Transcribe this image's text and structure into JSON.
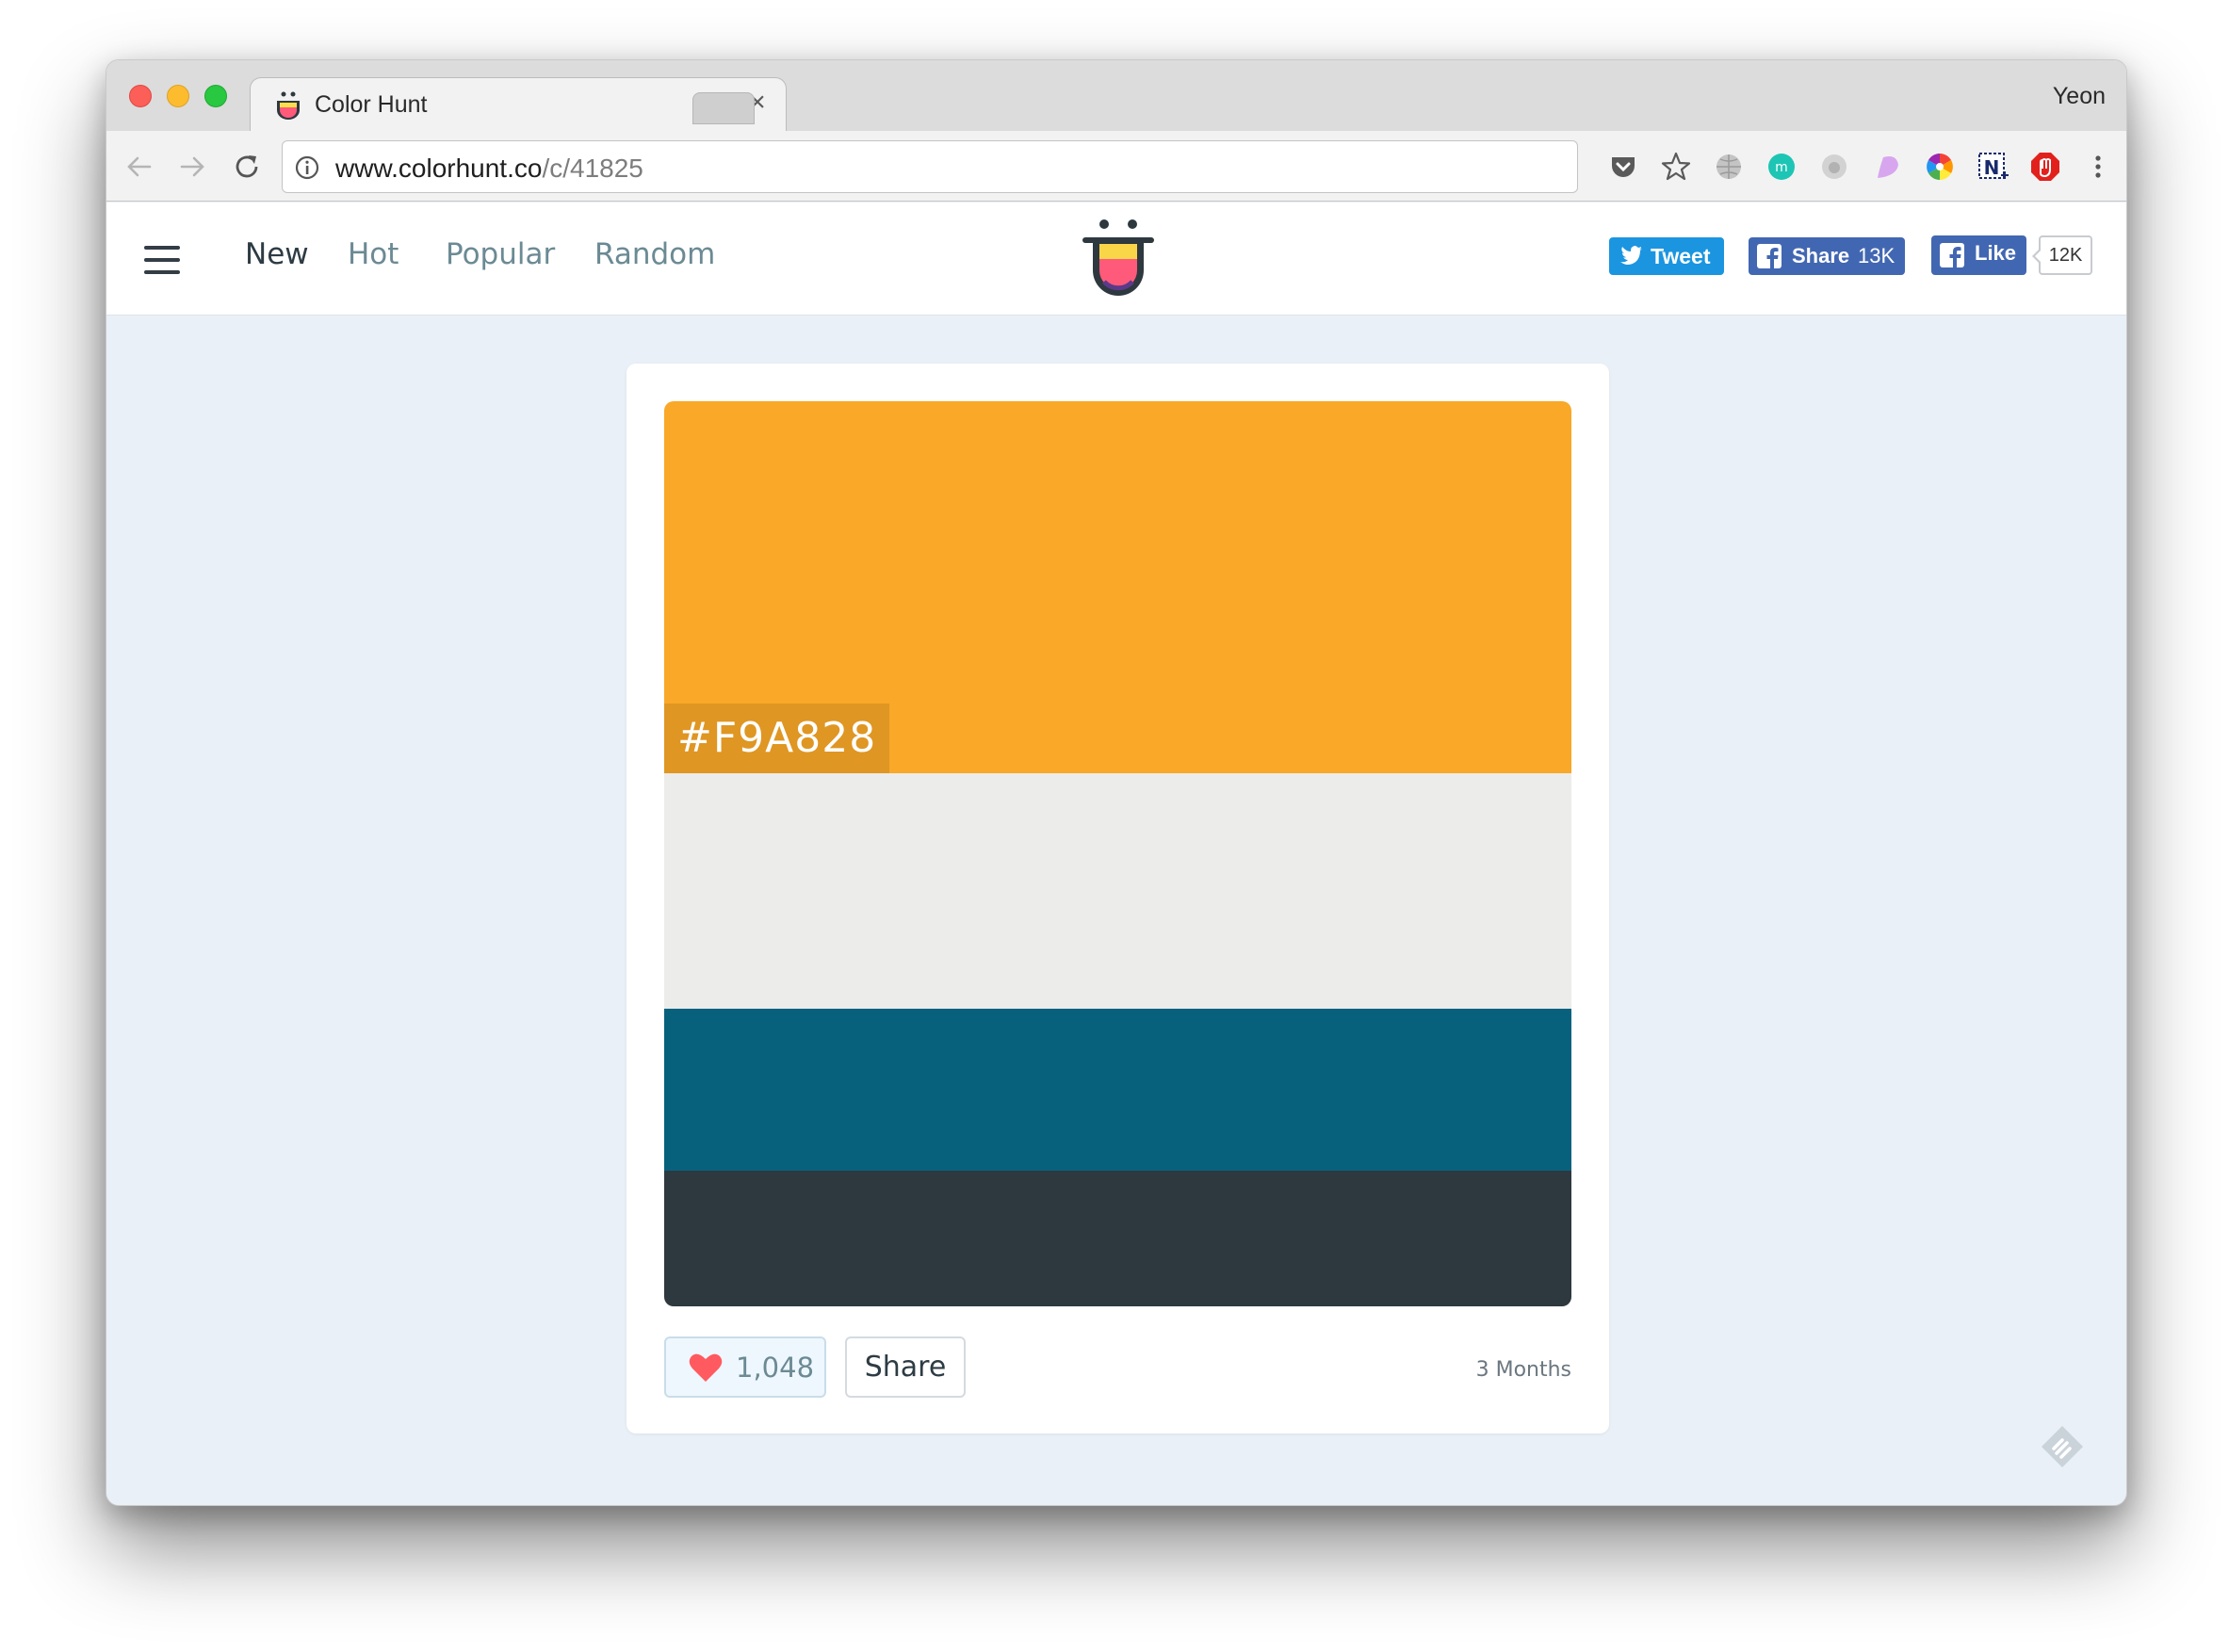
{
  "browser": {
    "tab_title": "Color Hunt",
    "tab_close": "×",
    "profile_name": "Yeon",
    "url_host": "www.colorhunt.co",
    "url_path": "/c/41825",
    "extensions": [
      "pocket-icon",
      "star-icon",
      "globe-icon",
      "m-extension-icon",
      "grey-extension-icon",
      "pink-extension-icon",
      "color-wheel-icon",
      "n-extension-icon",
      "adblock-icon",
      "menu-dots-icon"
    ]
  },
  "site": {
    "nav": {
      "new": "New",
      "hot": "Hot",
      "popular": "Popular",
      "random": "Random"
    },
    "social": {
      "tweet": "Tweet",
      "share": "Share",
      "share_count": "13K",
      "like": "Like",
      "like_count": "12K"
    }
  },
  "palette": {
    "colors": [
      "#F9A828",
      "#ECECEB",
      "#07617D",
      "#2E383F"
    ],
    "visible_hex": "#F9A828",
    "likes": "1,048",
    "share_label": "Share",
    "age": "3 Months"
  },
  "theme": {
    "page_bg": "#e9f0f7",
    "accent_heart": "#ff5a5f",
    "tweet_blue": "#1b95e0",
    "facebook_blue": "#4267b2"
  }
}
